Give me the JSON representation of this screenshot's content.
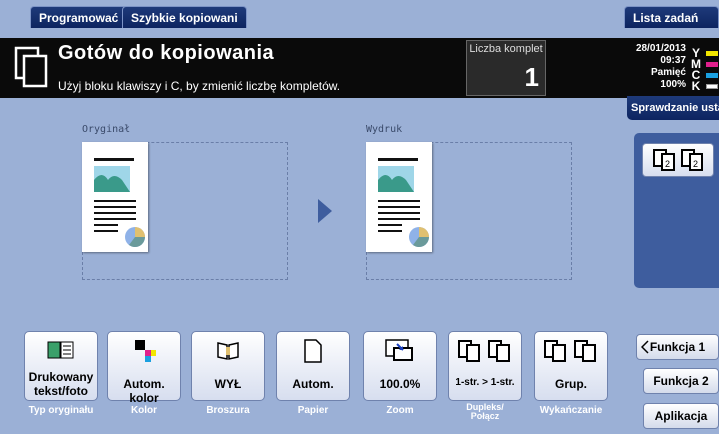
{
  "tabs": {
    "program": "Programować",
    "quick_copy": "Szybkie kopiowani",
    "job_list": "Lista zadań"
  },
  "header": {
    "title": "Gotów do kopiowania",
    "subtitle": "Użyj bloku klawiszy i C, by zmienić liczbę kompletów.",
    "copies_label": "Liczba komplet",
    "copies_value": "1",
    "date": "28/01/2013",
    "time": "09:37",
    "memory_label": "Pamięć",
    "memory_value": "100%",
    "toners": [
      "Y",
      "M",
      "C",
      "K"
    ]
  },
  "colors": {
    "toner_y": "#f2e600",
    "toner_m": "#e0208c",
    "toner_c": "#1aa0e0",
    "toner_k": "#222222"
  },
  "check_button": "Sprawdzanie usta",
  "preview": {
    "original_label": "Oryginał",
    "output_label": "Wydruk"
  },
  "function_buttons": [
    {
      "value": "Drukowany tekst/foto",
      "value_line1": "Drukowany",
      "value_line2": "tekst/foto",
      "label": "Typ oryginału",
      "icon": "text-photo-icon"
    },
    {
      "value": "Autom. kolor",
      "label": "Kolor",
      "icon": "auto-color-icon"
    },
    {
      "value": "WYŁ",
      "label": "Broszura",
      "icon": "booklet-icon"
    },
    {
      "value": "Autom.",
      "label": "Papier",
      "icon": "paper-icon"
    },
    {
      "value": "100.0%",
      "label": "Zoom",
      "icon": "zoom-icon"
    },
    {
      "value": "1-str. > 1-str.",
      "label": "Dupleks/ Połącz",
      "label_line1": "Dupleks/",
      "label_line2": "Połącz",
      "icon": "duplex-icon"
    },
    {
      "value": "Grup.",
      "label": "Wykańczanie",
      "icon": "group-icon"
    }
  ],
  "right_buttons": {
    "func1": "Funkcja 1",
    "func2": "Funkcja 2",
    "app": "Aplikacja"
  }
}
